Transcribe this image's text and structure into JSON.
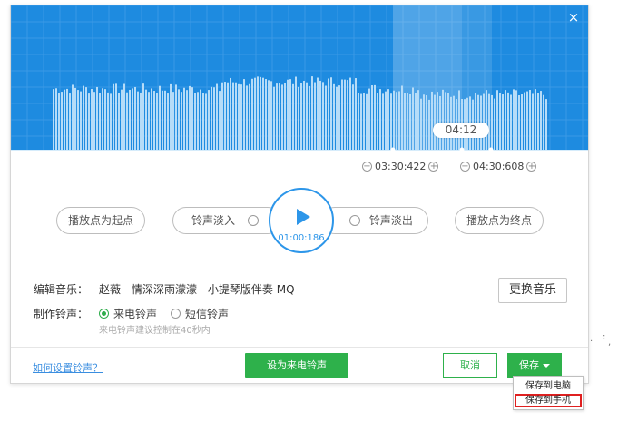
{
  "waveform": {
    "playhead_time": "04:12",
    "start_time": "03:30:422",
    "end_time": "04:30:608",
    "decrement_symbol": "−",
    "increment_symbol": "+",
    "bg_color": "#1e8be0",
    "bar_color": "#b6dcf8"
  },
  "dialog": {
    "close_symbol": "×"
  },
  "controls": {
    "set_start_label": "播放点为起点",
    "fade_in_label": "铃声淡入",
    "fade_out_label": "铃声淡出",
    "set_end_label": "播放点为终点",
    "play_time": "01:00:186"
  },
  "music": {
    "label": "编辑音乐：",
    "name": "赵薇 - 情深深雨濛濛 - 小提琴版伴奏  MQ",
    "change_label": "更换音乐"
  },
  "ringtone": {
    "label": "制作铃声：",
    "option_call": "来电铃声",
    "option_sms": "短信铃声",
    "selected": "来电铃声",
    "hint": "来电铃声建议控制在40秒内"
  },
  "footer": {
    "help_link": "如何设置铃声？",
    "set_ringtone_label": "设为来电铃声",
    "cancel_label": "取消",
    "save_label": "保存",
    "accent_color": "#2eb14b"
  },
  "save_menu": {
    "save_to_pc": "保存到电脑",
    "save_to_phone": "保存到手机"
  }
}
